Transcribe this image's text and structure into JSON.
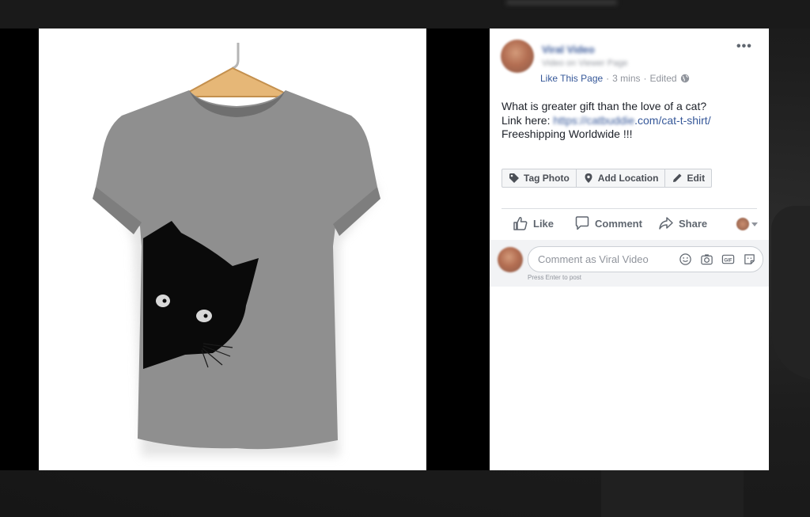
{
  "post": {
    "page_name": "Viral Video",
    "page_subtitle": "Video on Viewer Page",
    "like_page": "Like This Page",
    "separator": "·",
    "time": "3 mins",
    "edited": "Edited",
    "more": "•••",
    "text_line1": "What is greater gift than the love of a cat?",
    "text_link_prefix": "Link here: ",
    "text_link_domain": "https://catbuddie",
    "text_link_path": ".com/cat-t-shirt/",
    "text_line3": "Freeshipping Worldwide !!!"
  },
  "edit_bar": {
    "tag_photo": "Tag Photo",
    "add_location": "Add Location",
    "edit": "Edit"
  },
  "actions": {
    "like": "Like",
    "comment": "Comment",
    "share": "Share"
  },
  "comment_box": {
    "placeholder": "Comment as Viral Video",
    "hint": "Press Enter to post"
  },
  "icons": {
    "tag": "tag-icon",
    "location": "location-pin-icon",
    "edit": "pencil-icon",
    "like": "thumbs-up-icon",
    "comment": "speech-bubble-icon",
    "share": "share-arrow-icon",
    "emoji": "smiley-icon",
    "camera": "camera-icon",
    "gif": "gif-icon",
    "sticker": "sticker-icon",
    "audience": "globe-icon"
  },
  "colors": {
    "link": "#365899",
    "meta": "#90949c",
    "text": "#1d2129",
    "shirt": "#8f8f8f",
    "cat": "#0a0a0a"
  }
}
